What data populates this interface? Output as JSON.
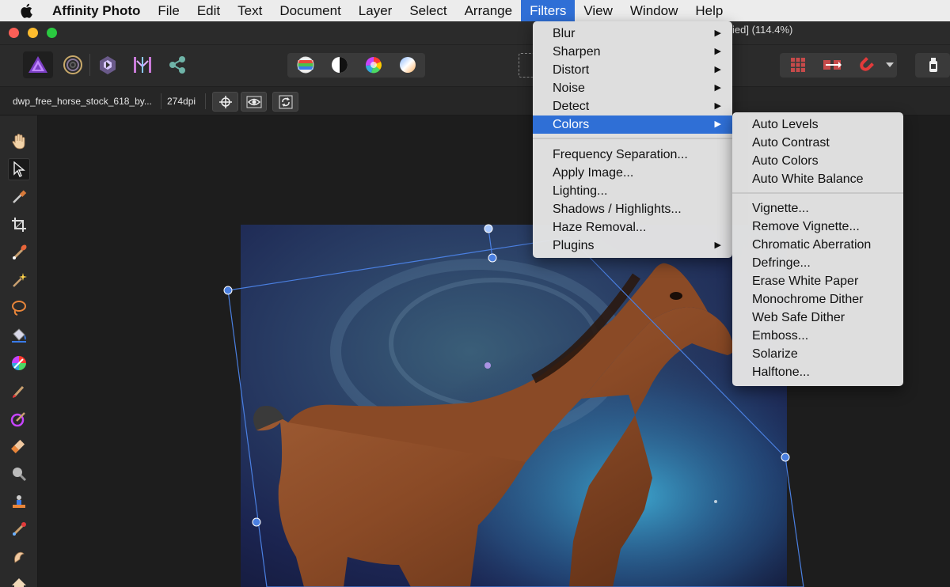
{
  "menubar": {
    "app_name": "Affinity Photo",
    "items": [
      "File",
      "Edit",
      "Text",
      "Document",
      "Layer",
      "Select",
      "Arrange",
      "Filters",
      "View",
      "Window",
      "Help"
    ],
    "active": "Filters"
  },
  "window": {
    "title_visible": "ied] (114.4%)"
  },
  "context": {
    "document_name": "dwp_free_horse_stock_618_by...",
    "dpi": "274dpi"
  },
  "filters_menu": {
    "items": [
      {
        "label": "Blur",
        "submenu": true
      },
      {
        "label": "Sharpen",
        "submenu": true
      },
      {
        "label": "Distort",
        "submenu": true
      },
      {
        "label": "Noise",
        "submenu": true
      },
      {
        "label": "Detect",
        "submenu": true
      },
      {
        "label": "Colors",
        "submenu": true,
        "highlighted": true
      },
      {
        "label": "Frequency Separation..."
      },
      {
        "label": "Apply Image..."
      },
      {
        "label": "Lighting..."
      },
      {
        "label": "Shadows / Highlights..."
      },
      {
        "label": "Haze Removal..."
      },
      {
        "label": "Plugins",
        "submenu": true
      }
    ]
  },
  "colors_submenu": {
    "items": [
      "Auto Levels",
      "Auto Contrast",
      "Auto Colors",
      "Auto White Balance",
      "Vignette...",
      "Remove Vignette...",
      "Chromatic Aberration",
      "Defringe...",
      "Erase White Paper",
      "Monochrome Dither",
      "Web Safe Dither",
      "Emboss...",
      "Solarize",
      "Halftone..."
    ]
  },
  "colors": {
    "accent": "#2f6fd6",
    "menu_bg": "#e4e4e4",
    "ui_dark": "#2b2b2b",
    "selection_line": "#4a7fe0"
  },
  "icons": {
    "apple": "apple-logo-icon",
    "personas": [
      "photo-persona-icon",
      "liquify-persona-icon",
      "develop-persona-icon",
      "tone-mapping-persona-icon",
      "export-persona-icon"
    ],
    "adjust": [
      "auto-levels-icon",
      "auto-contrast-icon",
      "auto-colors-icon",
      "auto-white-balance-icon"
    ],
    "right": [
      "snapping-grid-icon",
      "arrange-icon",
      "magnet-icon",
      "dropdown-arrow-icon",
      "assistant-icon"
    ],
    "tools": [
      "hand-icon",
      "move-icon",
      "color-picker-icon",
      "crop-icon",
      "selection-brush-icon",
      "flood-select-icon",
      "freehand-select-icon",
      "flood-fill-icon",
      "gradient-icon",
      "paint-brush-icon",
      "color-replacement-icon",
      "erase-brush-icon",
      "dodge-icon",
      "clone-icon",
      "healing-icon",
      "smudge-icon",
      "red-eye-icon"
    ]
  }
}
